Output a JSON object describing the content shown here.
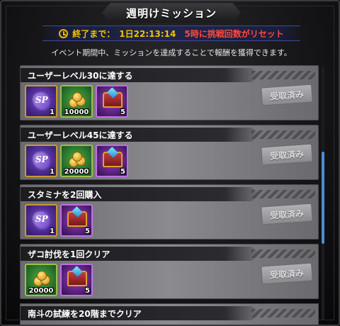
{
  "header": {
    "title": "週明けミッション"
  },
  "timer": {
    "icon": "clock-icon",
    "label": "終了まで：",
    "remaining": "1日22:13:14",
    "reset_notice": "5時に挑戦回数がリセット"
  },
  "description": "イベント期間中、ミッションを達成することで報酬を獲得できます。",
  "missions": [
    {
      "title": "ユーザーレベル30に達する",
      "status": "受取済み",
      "rewards": [
        {
          "type": "ticket",
          "icon": "ticket-icon",
          "qty": "1"
        },
        {
          "type": "coins",
          "icon": "coin-icon",
          "qty": "10000"
        },
        {
          "type": "chest",
          "icon": "chest-icon",
          "qty": "5"
        }
      ]
    },
    {
      "title": "ユーザーレベル45に達する",
      "status": "受取済み",
      "rewards": [
        {
          "type": "ticket",
          "icon": "ticket-icon",
          "qty": "1"
        },
        {
          "type": "coins",
          "icon": "coin-icon",
          "qty": "20000"
        },
        {
          "type": "chest",
          "icon": "chest-icon",
          "qty": "5"
        }
      ]
    },
    {
      "title": "スタミナを2回購入",
      "status": "受取済み",
      "rewards": [
        {
          "type": "ticket",
          "icon": "ticket-icon",
          "qty": "1"
        },
        {
          "type": "chest",
          "icon": "chest-icon",
          "qty": "5"
        }
      ]
    },
    {
      "title": "ザコ討伐を1回クリア",
      "status": "受取済み",
      "rewards": [
        {
          "type": "coins",
          "icon": "coin-icon",
          "qty": "20000"
        },
        {
          "type": "chest",
          "icon": "chest-icon",
          "qty": "5"
        }
      ]
    },
    {
      "title": "南斗の試練を20階までクリア",
      "status": "",
      "rewards": []
    }
  ]
}
